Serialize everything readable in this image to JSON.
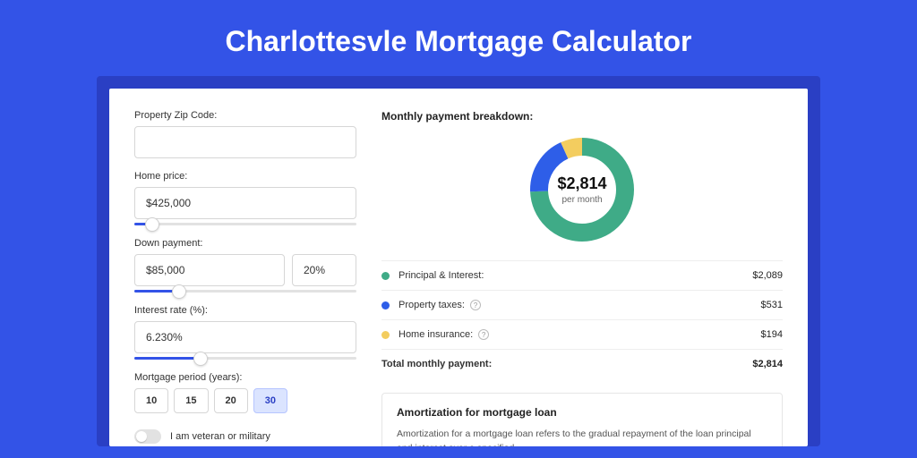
{
  "title": "Charlottesvle Mortgage Calculator",
  "form": {
    "zip_label": "Property Zip Code:",
    "zip_value": "",
    "home_price_label": "Home price:",
    "home_price_value": "$425,000",
    "home_price_slider_pct": 8,
    "down_payment_label": "Down payment:",
    "down_payment_value": "$85,000",
    "down_payment_pct_value": "20%",
    "down_payment_slider_pct": 20,
    "interest_label": "Interest rate (%):",
    "interest_value": "6.230%",
    "interest_slider_pct": 30,
    "period_label": "Mortgage period (years):",
    "periods": [
      "10",
      "15",
      "20",
      "30"
    ],
    "period_active": "30",
    "veteran_label": "I am veteran or military"
  },
  "breakdown": {
    "title": "Monthly payment breakdown:",
    "center_value": "$2,814",
    "center_sub": "per month",
    "items": [
      {
        "label": "Principal & Interest:",
        "value": "$2,089",
        "color": "#3fab87"
      },
      {
        "label": "Property taxes:",
        "value": "$531",
        "color": "#2e5ee8",
        "info": true
      },
      {
        "label": "Home insurance:",
        "value": "$194",
        "color": "#f3cd5f",
        "info": true
      }
    ],
    "total_label": "Total monthly payment:",
    "total_value": "$2,814"
  },
  "chart_data": {
    "type": "pie",
    "title": "Monthly payment breakdown",
    "series": [
      {
        "name": "Principal & Interest",
        "value": 2089,
        "color": "#3fab87"
      },
      {
        "name": "Property taxes",
        "value": 531,
        "color": "#2e5ee8"
      },
      {
        "name": "Home insurance",
        "value": 194,
        "color": "#f3cd5f"
      }
    ],
    "total": 2814
  },
  "amort": {
    "title": "Amortization for mortgage loan",
    "text": "Amortization for a mortgage loan refers to the gradual repayment of the loan principal and interest over a specified"
  }
}
